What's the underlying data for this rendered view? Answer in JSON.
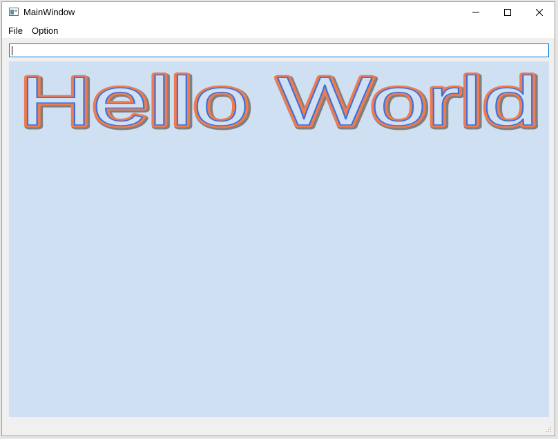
{
  "window": {
    "title": "MainWindow",
    "controls": {
      "minimize_icon": "minimize-icon",
      "maximize_icon": "maximize-icon",
      "close_icon": "close-icon"
    }
  },
  "menu": {
    "items": [
      {
        "label": "File"
      },
      {
        "label": "Option"
      }
    ]
  },
  "input": {
    "value": "",
    "placeholder": ""
  },
  "canvas": {
    "text": "Hello World",
    "background": "#cfe0f2",
    "text_fill": "#3a6fe0",
    "text_outline": "#f07b4e",
    "text_shadow": "#7f7f7f"
  },
  "colors": {
    "focus_border": "#0078d7",
    "title_bg": "#ffffff",
    "window_bg": "#f0f0f0"
  }
}
